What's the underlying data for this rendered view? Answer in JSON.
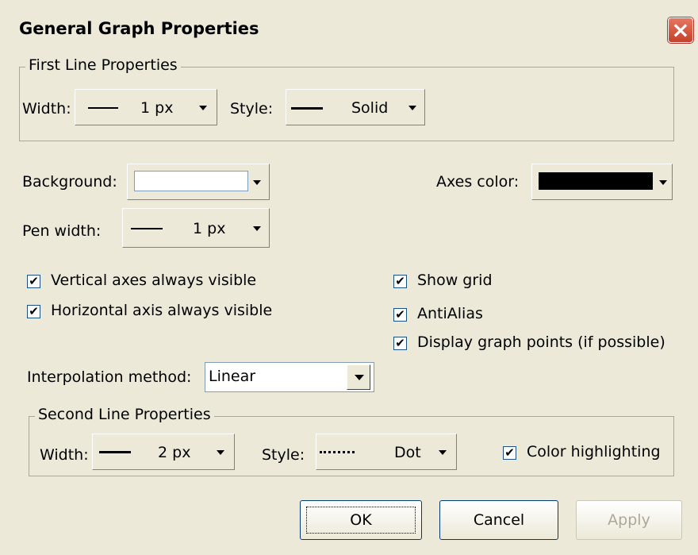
{
  "dialog": {
    "title": "General Graph Properties"
  },
  "first_line": {
    "legend": "First Line Properties",
    "width_label": "Width:",
    "width_value": "1 px",
    "style_label": "Style:",
    "style_value": "Solid"
  },
  "background": {
    "label": "Background:",
    "color": "#ffffff"
  },
  "axes_color": {
    "label": "Axes color:",
    "color": "#000000"
  },
  "pen_width": {
    "label": "Pen width:",
    "value": "1 px"
  },
  "checkboxes": {
    "vertical_axes": {
      "label": "Vertical axes always visible",
      "checked": true
    },
    "horizontal_axis": {
      "label": "Horizontal axis always visible",
      "checked": true
    },
    "show_grid": {
      "label": "Show grid",
      "checked": true
    },
    "antialias": {
      "label": "AntiAlias",
      "checked": true
    },
    "display_points": {
      "label": "Display graph points (if possible)",
      "checked": true
    }
  },
  "interpolation": {
    "label": "Interpolation method:",
    "value": "Linear"
  },
  "second_line": {
    "legend": "Second Line Properties",
    "width_label": "Width:",
    "width_value": "2 px",
    "style_label": "Style:",
    "style_value": "Dot",
    "color_highlighting": {
      "label": "Color highlighting",
      "checked": true
    }
  },
  "buttons": {
    "ok": "OK",
    "cancel": "Cancel",
    "apply": "Apply"
  }
}
